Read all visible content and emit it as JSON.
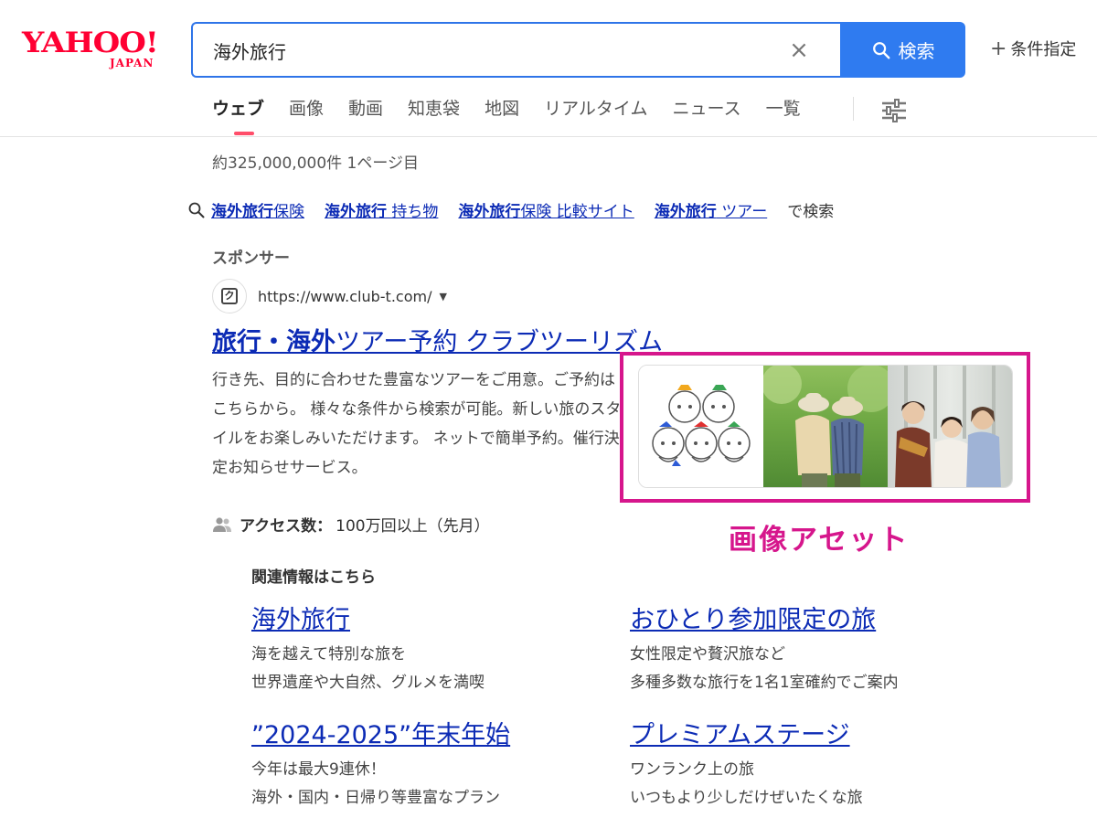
{
  "header": {
    "logo_text": "YAHOO!",
    "logo_sub": "JAPAN",
    "search_value": "海外旅行",
    "clear_label": "×",
    "search_button": "検索",
    "conditions_plus": "+",
    "conditions_label": "条件指定"
  },
  "tabs": [
    "ウェブ",
    "画像",
    "動画",
    "知恵袋",
    "地図",
    "リアルタイム",
    "ニュース",
    "一覧"
  ],
  "result_count": "約325,000,000件  1ページ目",
  "suggestions": {
    "items": [
      {
        "bold": "海外旅行",
        "rest": "保険"
      },
      {
        "bold": "海外旅行",
        "rest": " 持ち物"
      },
      {
        "bold": "海外旅行",
        "rest": "保険 比較サイト"
      },
      {
        "bold": "海外旅行",
        "rest": " ツアー"
      }
    ],
    "tail": "で検索"
  },
  "sponsor_label": "スポンサー",
  "ad": {
    "favicon_letter": "ク",
    "url": "https://www.club-t.com/",
    "title_bold": "旅行・海外",
    "title_rest": "ツアー予約 クラブツーリズム",
    "description": "行き先、目的に合わせた豊富なツアーをご用意。ご予約はこちらから。 様々な条件から検索が可能。新しい旅のスタイルをお楽しみいただけます。 ネットで簡単予約。催行決定お知らせサービス。",
    "access_label": "アクセス数：",
    "access_value": "100万回以上（先月）"
  },
  "image_asset_caption": "画像アセット",
  "related": {
    "heading": "関連情報はこちら",
    "items": [
      {
        "title": "海外旅行",
        "line1": "海を越えて特別な旅を",
        "line2": "世界遺産や大自然、グルメを満喫"
      },
      {
        "title": "おひとり参加限定の旅",
        "line1": "女性限定や贅沢旅など",
        "line2": "多種多数な旅行を1名1室確約でご案内"
      },
      {
        "title": "”2024-2025”年末年始",
        "line1": "今年は最大9連休！",
        "line2": "海外・国内・日帰り等豊富なプラン"
      },
      {
        "title": "プレミアムステージ",
        "line1": "ワンランク上の旅",
        "line2": "いつもより少しだけぜいたくな旅"
      }
    ]
  },
  "colors": {
    "brand_red": "#ff0033",
    "link_blue": "#0c2bb5",
    "search_blue": "#2f7bf0",
    "highlight_magenta": "#d6168c"
  }
}
